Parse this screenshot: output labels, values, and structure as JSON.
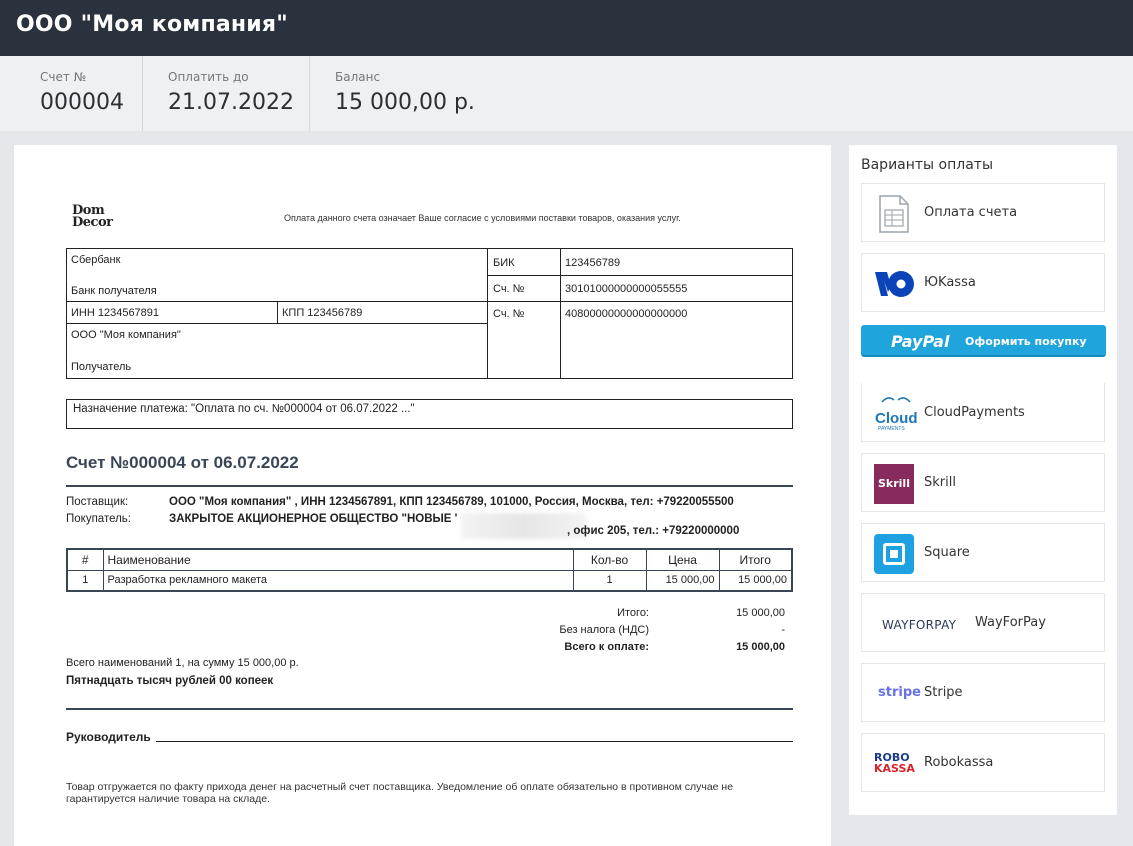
{
  "header": {
    "title": "ООО \"Моя компания\""
  },
  "summary": {
    "invoice_label": "Счет №",
    "invoice_value": "000004",
    "due_label": "Оплатить до",
    "due_value": "21.07.2022",
    "balance_label": "Баланс",
    "balance_value": "15 000,00 р."
  },
  "doc": {
    "logo_line1": "Dom",
    "logo_line2": "Decor",
    "consent": "Оплата данного счета означает Ваше согласие с условиями поставки товаров, оказания услуг.",
    "bank": {
      "bank_name": "Сбербанк",
      "bank_label": "Банк получателя",
      "bik_label": "БИК",
      "bik_value": "123456789",
      "corr_label": "Сч. №",
      "corr_value": "30101000000000055555",
      "inn": "ИНН 1234567891",
      "kpp": "КПП 123456789",
      "acc_label": "Сч. №",
      "acc_value": "40800000000000000000",
      "recipient_name": "ООО \"Моя компания\"",
      "recipient_label": "Получатель"
    },
    "purpose": "Назначение платежа: \"Оплата по сч. №000004 от 06.07.2022 ...\"",
    "invoice_title": "Счет №000004 от 06.07.2022",
    "supplier_label": "Поставщик:",
    "supplier_value": "ООО \"Моя компания\" , ИНН 1234567891, КПП 123456789, 101000, Россия, Москва, тел: +79220055500",
    "buyer_label": "Покупатель:",
    "buyer_value_1": "ЗАКРЫТОЕ АКЦИОНЕРНОЕ ОБЩЕСТВО \"НОВЫЕ '",
    "buyer_value_2": ", офис 205, тел.: +79220000000",
    "table": {
      "headers": [
        "#",
        "Наименование",
        "Кол-во",
        "Цена",
        "Итого"
      ],
      "rows": [
        [
          "1",
          "Разработка рекламного макета",
          "1",
          "15 000,00",
          "15 000,00"
        ]
      ]
    },
    "totals": {
      "subtotal_label": "Итого:",
      "subtotal_value": "15 000,00",
      "vat_label": "Без налога (НДС)",
      "vat_value": "-",
      "total_label": "Всего к оплате:",
      "total_value": "15 000,00"
    },
    "count_text": "Всего наименований 1, на сумму 15 000,00 р.",
    "words_text": "Пятнадцать тысяч рублей 00 копеек",
    "head_label": "Руководитель",
    "note": "Товар отгружается по факту прихода денег на расчетный счет поставщика. Уведомление об оплате обязательно в противном случае не гарантируется наличие товара на складе."
  },
  "payment": {
    "title": "Варианты оплаты",
    "invoice": "Оплата счета",
    "yookassa": "ЮKassa",
    "paypal_logo": "PayPal",
    "paypal_action": "Оформить покупку",
    "cloud_logo": "Cloud",
    "cloud_logo_sub": "PAYMENTS",
    "cloud": "CloudPayments",
    "skrill_logo": "Skrill",
    "skrill": "Skrill",
    "square": "Square",
    "wayforpay_logo": "WAYFORPAY",
    "wayforpay": "WayForPay",
    "stripe_logo": "stripe",
    "stripe": "Stripe",
    "robo_logo_1": "ROBO",
    "robo_logo_2": "KASSA",
    "robokassa": "Robokassa"
  }
}
